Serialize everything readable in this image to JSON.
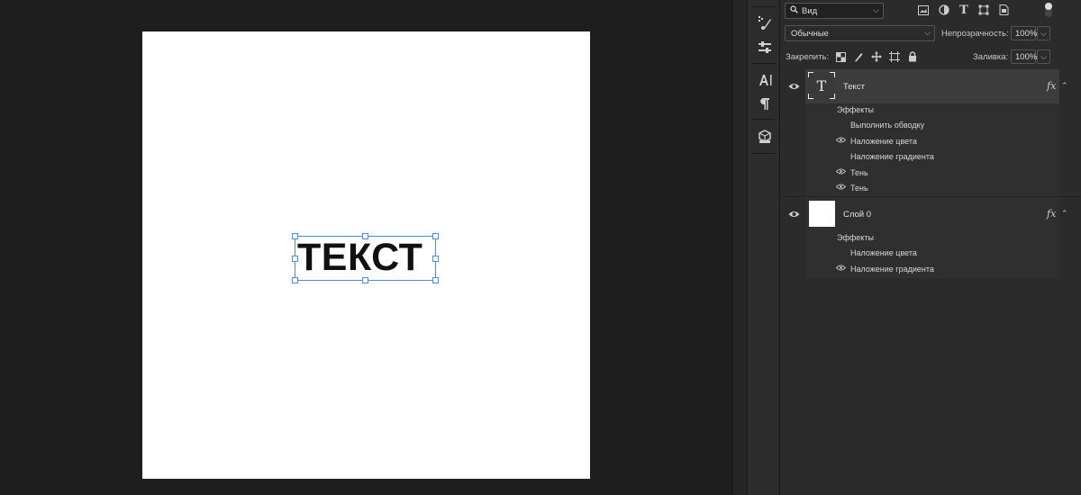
{
  "canvas": {
    "text": "ТЕКСТ"
  },
  "toolbar": {
    "icons": [
      "brush-settings-icon",
      "adjustments-icon",
      "character-icon",
      "paragraph-icon",
      "3d-icon"
    ]
  },
  "layers_panel": {
    "kind_filter": "Вид",
    "blend_mode": "Обычные",
    "opacity_label": "Непрозрачность:",
    "opacity_value": "100%",
    "lock_label": "Закрепить:",
    "fill_label": "Заливка:",
    "fill_value": "100%",
    "layers": [
      {
        "name": "Текст",
        "type": "text",
        "thumb_glyph": "T",
        "fx": "fx",
        "effects_label": "Эффекты",
        "effects": [
          {
            "name": "Выполнить обводку",
            "visible": false
          },
          {
            "name": "Наложение цвета",
            "visible": true
          },
          {
            "name": "Наложение градиента",
            "visible": false
          },
          {
            "name": "Тень",
            "visible": true
          },
          {
            "name": "Тень",
            "visible": true
          }
        ]
      },
      {
        "name": "Слой 0",
        "type": "raster",
        "fx": "fx",
        "effects_label": "Эффекты",
        "effects": [
          {
            "name": "Наложение цвета",
            "visible": false
          },
          {
            "name": "Наложение градиента",
            "visible": true
          }
        ]
      }
    ]
  },
  "colors": {
    "panel_bg": "#2b2b2b",
    "selected_layer_bg": "#3c3c3c",
    "selection_box": "#4a90e2"
  }
}
